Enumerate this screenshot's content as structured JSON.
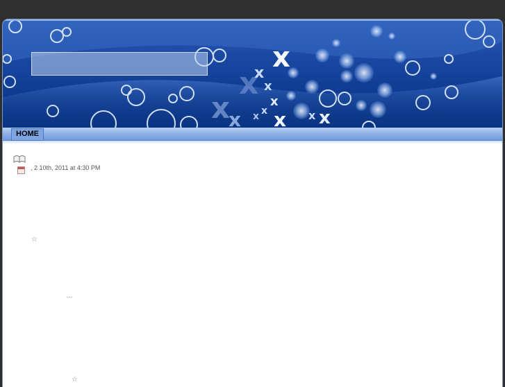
{
  "header": {
    "title": ""
  },
  "nav": {
    "items": [
      {
        "label": "HOME"
      }
    ]
  },
  "post": {
    "date_line": ", 2  10th, 2011 at 4:30 PM",
    "glyphs": {
      "star_1": "☆",
      "ellipsis": "…",
      "star_2": "☆"
    }
  },
  "colors": {
    "background": "#2f2f2f",
    "header_blue": "#0f3c92",
    "nav_blue": "#8db0e6",
    "content": "#ffffff"
  },
  "icons": [
    "post-icon",
    "calendar-icon"
  ]
}
